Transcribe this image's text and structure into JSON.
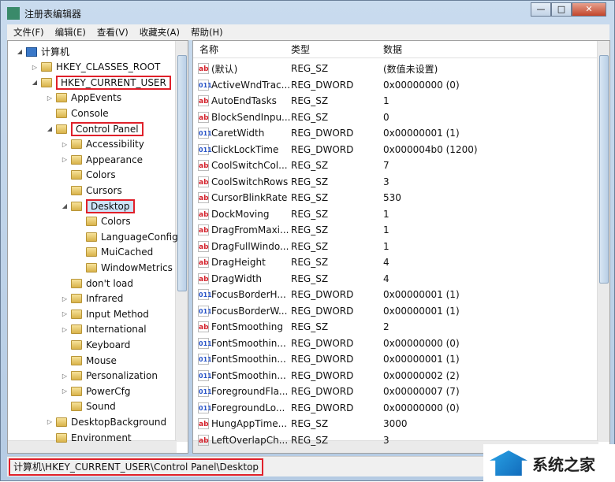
{
  "window": {
    "title": "注册表编辑器",
    "controls": [
      "—",
      "□",
      "✕"
    ]
  },
  "menu": [
    "文件(F)",
    "编辑(E)",
    "查看(V)",
    "收藏夹(A)",
    "帮助(H)"
  ],
  "tree": [
    {
      "label": "计算机",
      "level": 0,
      "toggle": "◢",
      "icon": "computer"
    },
    {
      "label": "HKEY_CLASSES_ROOT",
      "level": 1,
      "toggle": "▷"
    },
    {
      "label": "HKEY_CURRENT_USER",
      "level": 1,
      "toggle": "◢",
      "highlight": true
    },
    {
      "label": "AppEvents",
      "level": 2,
      "toggle": "▷"
    },
    {
      "label": "Console",
      "level": 2,
      "toggle": ""
    },
    {
      "label": "Control Panel",
      "level": 2,
      "toggle": "◢",
      "highlight": true
    },
    {
      "label": "Accessibility",
      "level": 3,
      "toggle": "▷"
    },
    {
      "label": "Appearance",
      "level": 3,
      "toggle": "▷"
    },
    {
      "label": "Colors",
      "level": 3,
      "toggle": ""
    },
    {
      "label": "Cursors",
      "level": 3,
      "toggle": ""
    },
    {
      "label": "Desktop",
      "level": 3,
      "toggle": "◢",
      "highlight": true,
      "selected": true
    },
    {
      "label": "Colors",
      "level": 4,
      "toggle": ""
    },
    {
      "label": "LanguageConfig",
      "level": 4,
      "toggle": ""
    },
    {
      "label": "MuiCached",
      "level": 4,
      "toggle": ""
    },
    {
      "label": "WindowMetrics",
      "level": 4,
      "toggle": ""
    },
    {
      "label": "don't load",
      "level": 3,
      "toggle": ""
    },
    {
      "label": "Infrared",
      "level": 3,
      "toggle": "▷"
    },
    {
      "label": "Input Method",
      "level": 3,
      "toggle": "▷"
    },
    {
      "label": "International",
      "level": 3,
      "toggle": "▷"
    },
    {
      "label": "Keyboard",
      "level": 3,
      "toggle": ""
    },
    {
      "label": "Mouse",
      "level": 3,
      "toggle": ""
    },
    {
      "label": "Personalization",
      "level": 3,
      "toggle": "▷"
    },
    {
      "label": "PowerCfg",
      "level": 3,
      "toggle": "▷"
    },
    {
      "label": "Sound",
      "level": 3,
      "toggle": ""
    },
    {
      "label": "DesktopBackground",
      "level": 2,
      "toggle": "▷"
    },
    {
      "label": "Environment",
      "level": 2,
      "toggle": ""
    }
  ],
  "columns": [
    "名称",
    "类型",
    "数据"
  ],
  "values": [
    [
      "(默认)",
      "REG_SZ",
      "(数值未设置)"
    ],
    [
      "ActiveWndTrac...",
      "REG_DWORD",
      "0x00000000 (0)"
    ],
    [
      "AutoEndTasks",
      "REG_SZ",
      "1"
    ],
    [
      "BlockSendInpu...",
      "REG_SZ",
      "0"
    ],
    [
      "CaretWidth",
      "REG_DWORD",
      "0x00000001 (1)"
    ],
    [
      "ClickLockTime",
      "REG_DWORD",
      "0x000004b0 (1200)"
    ],
    [
      "CoolSwitchCol...",
      "REG_SZ",
      "7"
    ],
    [
      "CoolSwitchRows",
      "REG_SZ",
      "3"
    ],
    [
      "CursorBlinkRate",
      "REG_SZ",
      "530"
    ],
    [
      "DockMoving",
      "REG_SZ",
      "1"
    ],
    [
      "DragFromMaxi...",
      "REG_SZ",
      "1"
    ],
    [
      "DragFullWindo...",
      "REG_SZ",
      "1"
    ],
    [
      "DragHeight",
      "REG_SZ",
      "4"
    ],
    [
      "DragWidth",
      "REG_SZ",
      "4"
    ],
    [
      "FocusBorderH...",
      "REG_DWORD",
      "0x00000001 (1)"
    ],
    [
      "FocusBorderW...",
      "REG_DWORD",
      "0x00000001 (1)"
    ],
    [
      "FontSmoothing",
      "REG_SZ",
      "2"
    ],
    [
      "FontSmoothin...",
      "REG_DWORD",
      "0x00000000 (0)"
    ],
    [
      "FontSmoothin...",
      "REG_DWORD",
      "0x00000001 (1)"
    ],
    [
      "FontSmoothin...",
      "REG_DWORD",
      "0x00000002 (2)"
    ],
    [
      "ForegroundFla...",
      "REG_DWORD",
      "0x00000007 (7)"
    ],
    [
      "ForegroundLo...",
      "REG_DWORD",
      "0x00000000 (0)"
    ],
    [
      "HungAppTime...",
      "REG_SZ",
      "3000"
    ],
    [
      "LeftOverlapCh...",
      "REG_SZ",
      "3"
    ]
  ],
  "status": "计算机\\HKEY_CURRENT_USER\\Control Panel\\Desktop",
  "watermark": "系统之家",
  "colors": {
    "highlight": "#e0202a",
    "reg_sz": "#d3202a",
    "reg_dword": "#2a55c8"
  }
}
